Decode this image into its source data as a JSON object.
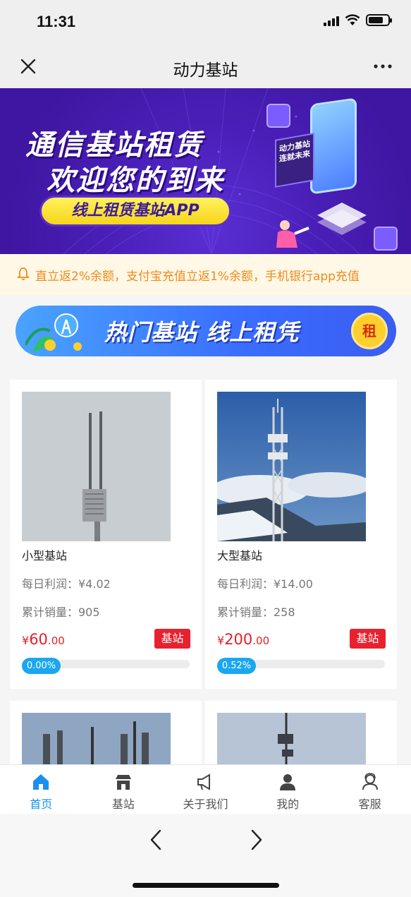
{
  "status": {
    "time": "11:31"
  },
  "nav": {
    "title": "动力基站"
  },
  "banner": {
    "line1": "通信基站租赁",
    "line2": "欢迎您的到来",
    "pill": "线上租赁基站APP",
    "tag": "动力基站 连就未来"
  },
  "notice": {
    "text": "直立返2%余额，支付宝充值立返1%余额，手机银行app充值"
  },
  "hot_banner": {
    "text": "热门基站 线上租凭",
    "coin": "租"
  },
  "products": [
    {
      "name": "小型基站",
      "profit": "每日利润：¥4.02",
      "sales": "累计销量：905",
      "price_symbol": "¥",
      "price_int": "60",
      "price_dec": ".00",
      "badge": "基站",
      "progress": "0.00%"
    },
    {
      "name": "大型基站",
      "profit": "每日利润：¥14.00",
      "sales": "累计销量：258",
      "price_symbol": "¥",
      "price_int": "200",
      "price_dec": ".00",
      "badge": "基站",
      "progress": "0.52%"
    }
  ],
  "tabs": [
    {
      "label": "首页",
      "icon": "home-icon",
      "active": true
    },
    {
      "label": "基站",
      "icon": "store-icon",
      "active": false
    },
    {
      "label": "关于我们",
      "icon": "megaphone-icon",
      "active": false
    },
    {
      "label": "我的",
      "icon": "user-icon",
      "active": false
    },
    {
      "label": "客服",
      "icon": "support-icon",
      "active": false
    }
  ],
  "colors": {
    "accent": "#1a8ff0",
    "price": "#e4202b",
    "notice": "#f08a1c",
    "banner": "#4a1fb8"
  }
}
